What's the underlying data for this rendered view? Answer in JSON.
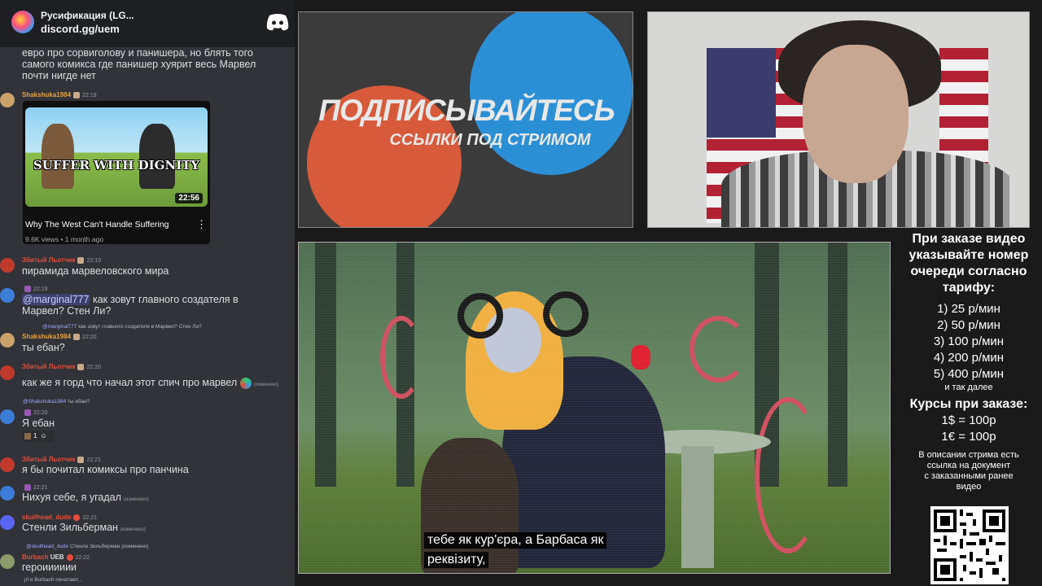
{
  "chat": {
    "server_name": "Русификация (LG...",
    "invite": "discord.gg/uem",
    "top_text": "евро про сорвиголову и панишера, но блять того самого комикса где панишер хуярит весь Марвел почти нигде нет",
    "messages": [
      {
        "user": "Shakshuka1984",
        "time": "22:19",
        "text": "",
        "color": "#e6a23c"
      },
      {
        "user": "Збитый Льотчик",
        "time": "22:19",
        "text": "пирамида марвеловского мира",
        "color": "#e74c3c"
      },
      {
        "user": "",
        "time": "22:19",
        "text_mention": "@marginal777",
        "text": "как зовут главного создателя в Марвел? Стен Ли?"
      },
      {
        "user": "Shakshuka1984",
        "time": "22:20",
        "text": "ты ебан?",
        "color": "#e6a23c",
        "reply_user": "@marginal777",
        "reply_text": "как зовут главного создателя в Марвел? Стен Ли?"
      },
      {
        "user": "Збитый Льотчик",
        "time": "22:20",
        "text": "как же я горд что начал этот спич про марвел",
        "edited": "(изменено)",
        "color": "#e74c3c"
      },
      {
        "user": "",
        "time": "22:20",
        "text": "Я ебан",
        "reply_user": "@Shakshuka1984",
        "reply_text": "ты ебан?",
        "reaction_count": "1"
      },
      {
        "user": "Збитый Льотчик",
        "time": "22:21",
        "text": "я бы почитал комиксы про панчина",
        "color": "#e74c3c"
      },
      {
        "user": "",
        "time": "22:21",
        "text": "Нихуя себе, я угадал",
        "edited": "(изменено)"
      },
      {
        "user": "skullhead_dude",
        "time": "22:21",
        "text": "Стенли Зильберман",
        "edited": "(изменено)",
        "color": "#e74c3c"
      },
      {
        "user": "Burbach",
        "tag": "UEB",
        "time": "22:22",
        "text": "героииииии",
        "color": "#e74c3c",
        "reply_user": "@skullhead_dude",
        "reply_text": "Стенли Зильберман",
        "reply_edited": "(изменено)"
      }
    ],
    "typing": "jrl и Burbach печатают...",
    "embed": {
      "thumb_text": "SUFFER WITH DIGNITY",
      "duration": "22:56",
      "title": "Why The West Can't Handle Suffering",
      "meta": "9.6K views • 1 month ago"
    }
  },
  "promo": {
    "title": "ПОДПИСЫВАЙТЕСЬ",
    "subtitle": "ССЫЛКИ ПОД СТРИМОМ"
  },
  "video": {
    "subtitle_line1": "тебе як кур'єра, а Барбаса як",
    "subtitle_line2": "реквізиту,"
  },
  "info": {
    "heading": [
      "При заказе видео",
      "указывайте номер",
      "очереди согласно",
      "тарифу:"
    ],
    "tariffs": [
      "1) 25 р/мин",
      "2) 50 р/мин",
      "3) 100 р/мин",
      "4) 200 р/мин",
      "5) 400 р/мин"
    ],
    "and_more": "и так далее",
    "rates_heading": "Курсы при заказе:",
    "rates": [
      "1$ = 100р",
      "1€ = 100р"
    ],
    "description": [
      "В описании стрима есть",
      "ссылка на документ",
      "с заказанными ранее",
      "видео"
    ]
  },
  "colors": {
    "chat_bg": "#313338",
    "chat_header_bg": "#1e1f22",
    "accent_red": "#e74c3c",
    "accent_orange": "#e6a23c"
  }
}
